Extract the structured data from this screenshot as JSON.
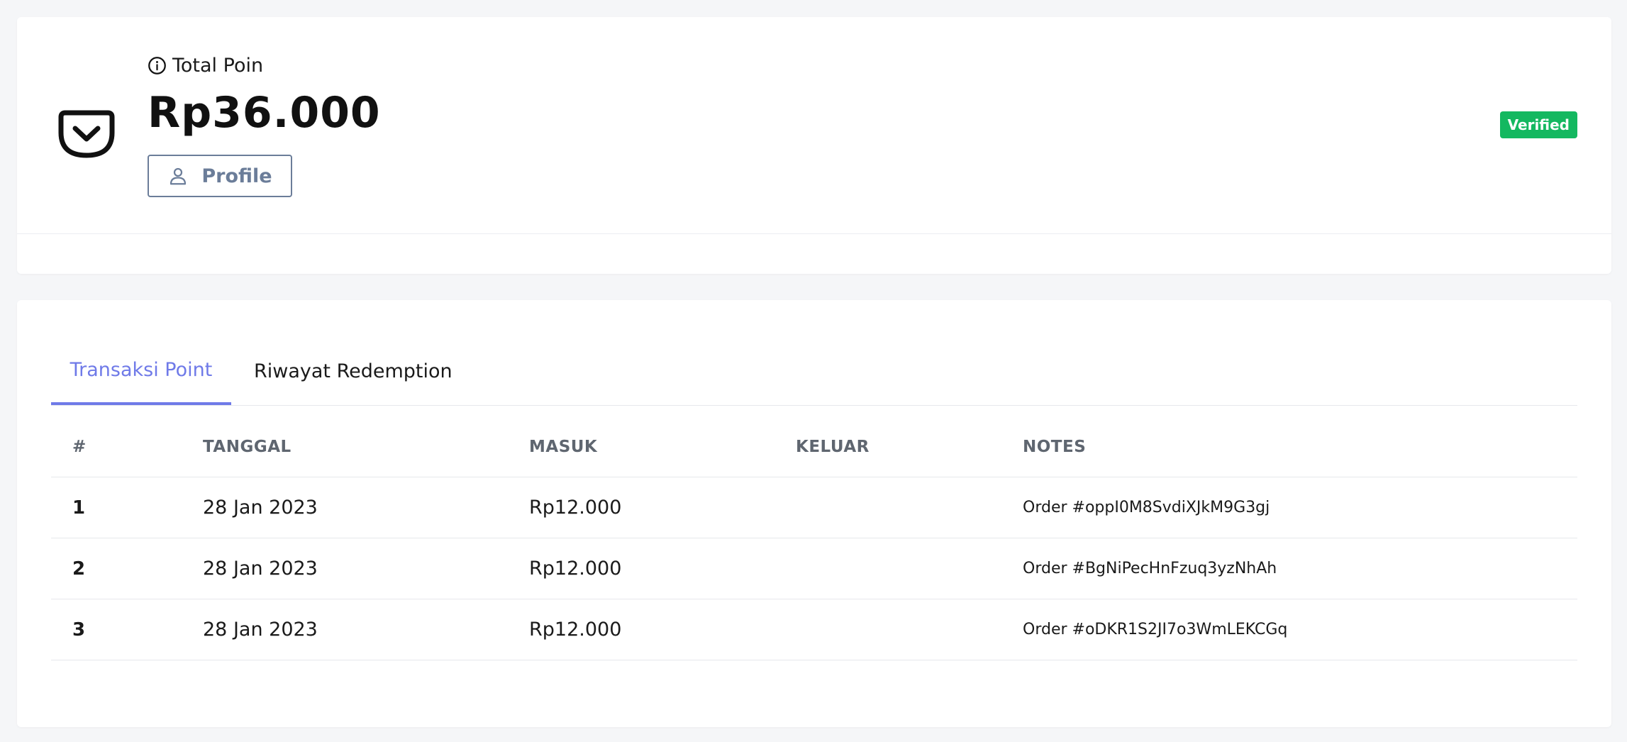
{
  "summary": {
    "total_label": "Total Poin",
    "total_amount": "Rp36.000",
    "profile_button": "Profile",
    "status_badge": "Verified",
    "badge_color": "#14b860"
  },
  "tabs": [
    {
      "label": "Transaksi Point",
      "active": true
    },
    {
      "label": "Riwayat Redemption",
      "active": false
    }
  ],
  "accent_color": "#6f7ae8",
  "table": {
    "headers": [
      "#",
      "TANGGAL",
      "MASUK",
      "KELUAR",
      "NOTES"
    ],
    "rows": [
      {
        "no": "1",
        "date": "28 Jan 2023",
        "in": "Rp12.000",
        "out": "",
        "notes": "Order #oppI0M8SvdiXJkM9G3gj"
      },
      {
        "no": "2",
        "date": "28 Jan 2023",
        "in": "Rp12.000",
        "out": "",
        "notes": "Order #BgNiPecHnFzuq3yzNhAh"
      },
      {
        "no": "3",
        "date": "28 Jan 2023",
        "in": "Rp12.000",
        "out": "",
        "notes": "Order #oDKR1S2JI7o3WmLEKCGq"
      }
    ]
  },
  "icons": [
    "pocket-icon",
    "info-icon",
    "user-icon"
  ]
}
